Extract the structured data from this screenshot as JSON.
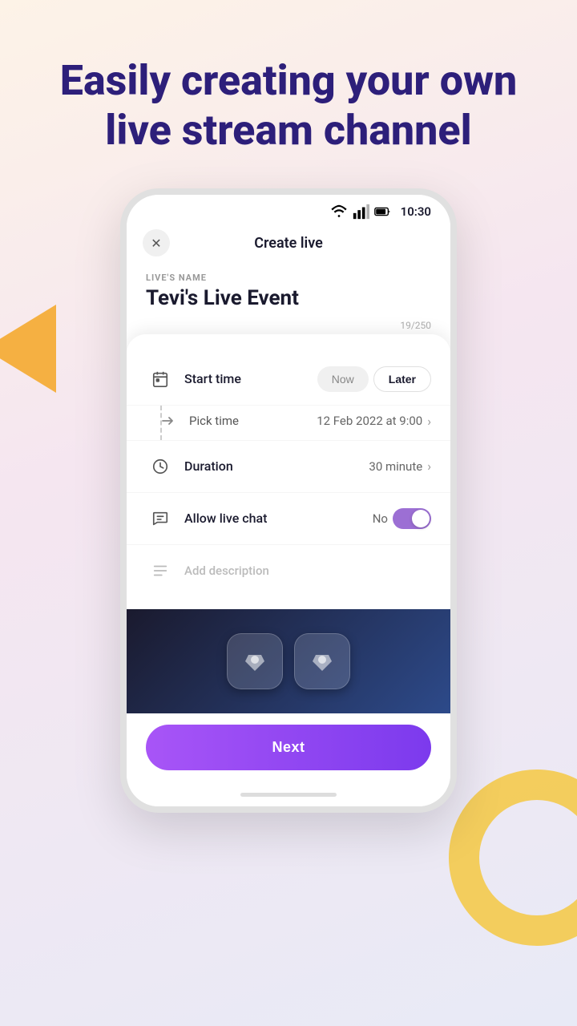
{
  "hero": {
    "title": "Easily creating your own live stream channel"
  },
  "status_bar": {
    "time": "10:30"
  },
  "header": {
    "title": "Create live",
    "close_label": "×"
  },
  "live_name": {
    "label": "LIVE'S NAME",
    "value": "Tevi's Live Event",
    "char_count": "19/250"
  },
  "start_time": {
    "label": "Start time",
    "btn_now": "Now",
    "btn_later": "Later"
  },
  "pick_time": {
    "label": "Pick time",
    "value": "12 Feb 2022 at 9:00"
  },
  "duration": {
    "label": "Duration",
    "value": "30 minute"
  },
  "allow_chat": {
    "label": "Allow live chat",
    "status": "No"
  },
  "description": {
    "placeholder": "Add description"
  },
  "next_button": {
    "label": "Next"
  }
}
